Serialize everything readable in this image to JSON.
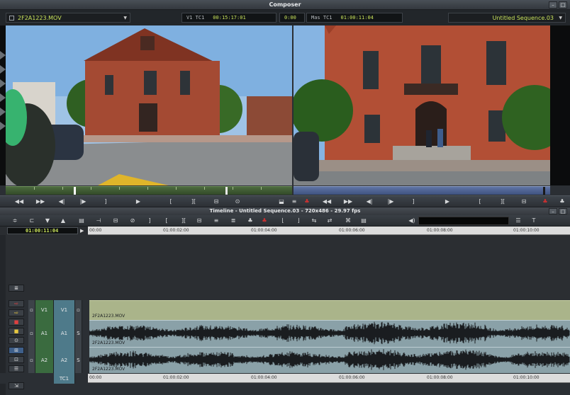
{
  "composer": {
    "title": "Composer",
    "source_clip": "2F2A1223.MOV",
    "source_track_label": "V1 TC1",
    "source_tc": "00:15:17:01",
    "duration_val": "0:00",
    "record_track_label": "Mas TC1",
    "record_tc": "01:00:11:04",
    "sequence_name": "Untitled Sequence.03"
  },
  "timeline": {
    "title": "Timeline - Untitled Sequence.03 - 720x486 - 29.97 fps",
    "current_tc": "01:00:11:04",
    "ruler_labels": [
      "00:00",
      "01:00:02:00",
      "01:00:04:00",
      "01:00:06:00",
      "01:00:08:00",
      "01:00:10:00"
    ],
    "tracks": [
      {
        "sel": "V1",
        "rec": "V1",
        "clip": "2F2A1223.MOV"
      },
      {
        "sel": "A1",
        "rec": "A1",
        "clip": "2F2A1223.MOV"
      },
      {
        "sel": "A2",
        "rec": "A2",
        "clip": "2F2A1223.MOV"
      }
    ],
    "tc_track": "TC1"
  },
  "colors": {
    "accent_green": "#c8e25a",
    "source_bar": "#4c6a3e",
    "record_bar": "#5e74a4",
    "video_clip": "#aab48a",
    "audio_clip": "#8aa1a8"
  }
}
